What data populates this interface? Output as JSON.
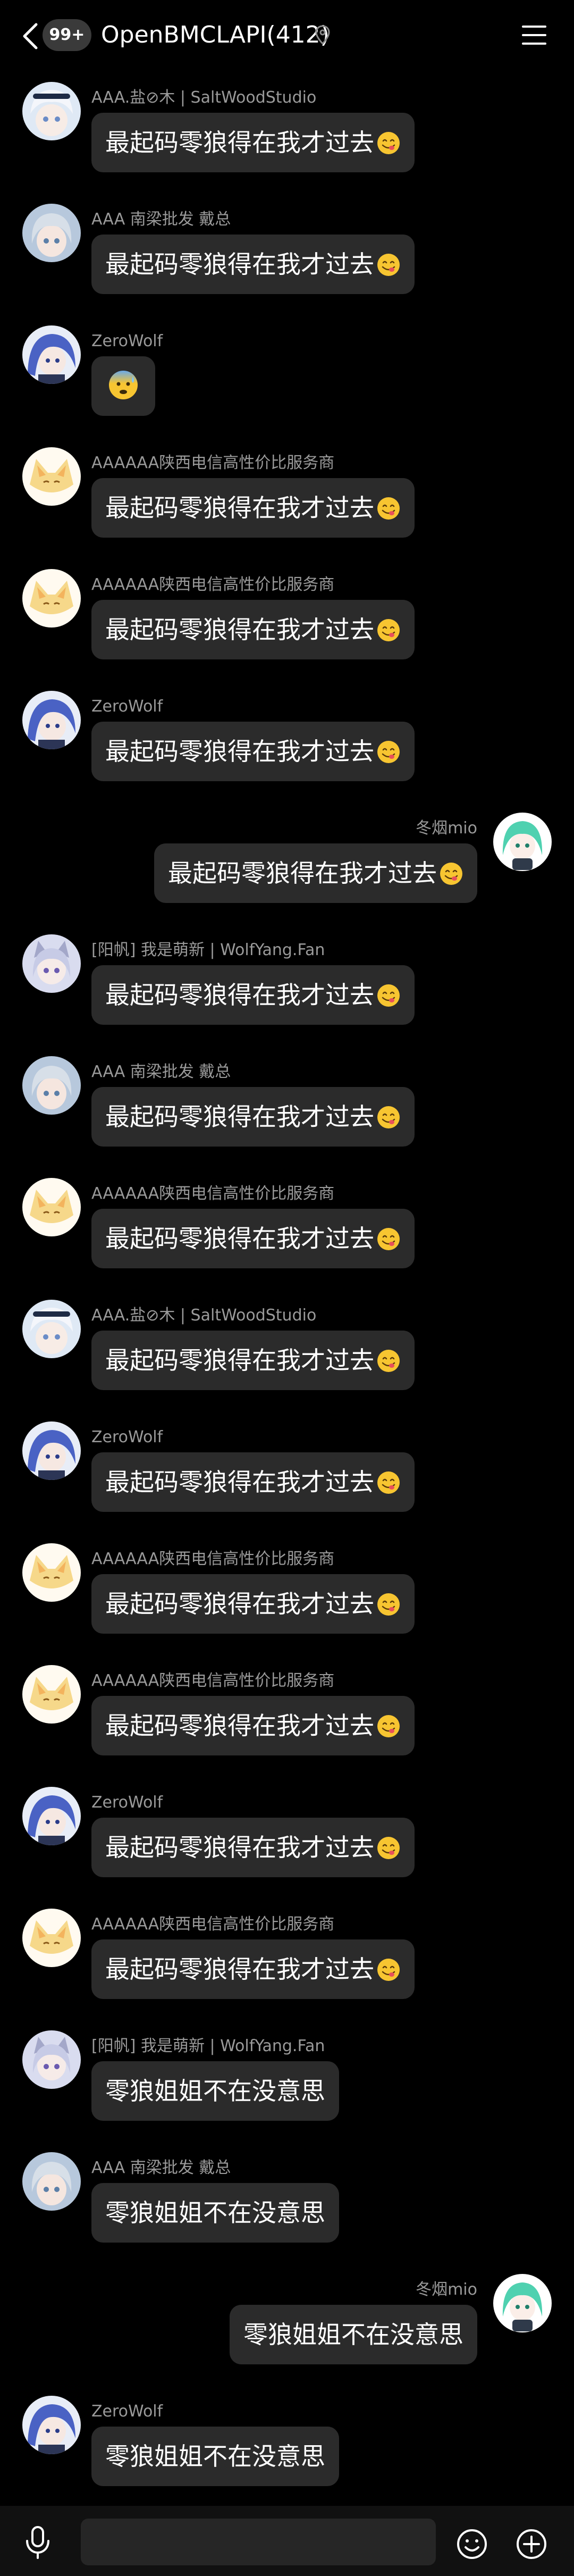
{
  "header": {
    "unread_badge": "99+",
    "title": "OpenBMCLAPI(412)"
  },
  "colors": {
    "background": "#000000",
    "bubble": "#2b2b2b",
    "sender_text": "#9a9a9a",
    "badge": "#3a3a3a"
  },
  "messages": [
    {
      "sender": "AAA.盐⊘木 | SaltWoodStudio",
      "text": "最起码零狼得在我才过去",
      "emoji": "face-savoring-food",
      "side": "left",
      "avatar": "avatar-white-hair"
    },
    {
      "sender": "AAA 南梁批发 戴总",
      "text": "最起码零狼得在我才过去",
      "emoji": "face-savoring-food",
      "side": "left",
      "avatar": "avatar-silver-hair"
    },
    {
      "sender": "ZeroWolf",
      "text": "",
      "emoji": "anxious-face-with-sweat",
      "side": "left",
      "avatar": "avatar-blue-hair"
    },
    {
      "sender": "AAAAAA陕西电信高性价比服务商",
      "text": "最起码零狼得在我才过去",
      "emoji": "face-savoring-food",
      "side": "left",
      "avatar": "avatar-fox"
    },
    {
      "sender": "AAAAAA陕西电信高性价比服务商",
      "text": "最起码零狼得在我才过去",
      "emoji": "face-savoring-food",
      "side": "left",
      "avatar": "avatar-fox"
    },
    {
      "sender": "ZeroWolf",
      "text": "最起码零狼得在我才过去",
      "emoji": "face-savoring-food",
      "side": "left",
      "avatar": "avatar-blue-hair"
    },
    {
      "sender": "冬烟mio",
      "text": "最起码零狼得在我才过去",
      "emoji": "face-savoring-food",
      "side": "right",
      "avatar": "avatar-green-hair"
    },
    {
      "sender": "[阳帆] 我是萌新 | WolfYang.Fan",
      "text": "最起码零狼得在我才过去",
      "emoji": "face-savoring-food",
      "side": "left",
      "avatar": "avatar-wolf-girl"
    },
    {
      "sender": "AAA 南梁批发 戴总",
      "text": "最起码零狼得在我才过去",
      "emoji": "face-savoring-food",
      "side": "left",
      "avatar": "avatar-silver-hair"
    },
    {
      "sender": "AAAAAA陕西电信高性价比服务商",
      "text": "最起码零狼得在我才过去",
      "emoji": "face-savoring-food",
      "side": "left",
      "avatar": "avatar-fox"
    },
    {
      "sender": "AAA.盐⊘木 | SaltWoodStudio",
      "text": "最起码零狼得在我才过去",
      "emoji": "face-savoring-food",
      "side": "left",
      "avatar": "avatar-white-hair"
    },
    {
      "sender": "ZeroWolf",
      "text": "最起码零狼得在我才过去",
      "emoji": "face-savoring-food",
      "side": "left",
      "avatar": "avatar-blue-hair"
    },
    {
      "sender": "AAAAAA陕西电信高性价比服务商",
      "text": "最起码零狼得在我才过去",
      "emoji": "face-savoring-food",
      "side": "left",
      "avatar": "avatar-fox"
    },
    {
      "sender": "AAAAAA陕西电信高性价比服务商",
      "text": "最起码零狼得在我才过去",
      "emoji": "face-savoring-food",
      "side": "left",
      "avatar": "avatar-fox"
    },
    {
      "sender": "ZeroWolf",
      "text": "最起码零狼得在我才过去",
      "emoji": "face-savoring-food",
      "side": "left",
      "avatar": "avatar-blue-hair"
    },
    {
      "sender": "AAAAAA陕西电信高性价比服务商",
      "text": "最起码零狼得在我才过去",
      "emoji": "face-savoring-food",
      "side": "left",
      "avatar": "avatar-fox"
    },
    {
      "sender": "[阳帆] 我是萌新 | WolfYang.Fan",
      "text": "零狼姐姐不在没意思",
      "emoji": "",
      "side": "left",
      "avatar": "avatar-wolf-girl"
    },
    {
      "sender": "AAA 南梁批发 戴总",
      "text": "零狼姐姐不在没意思",
      "emoji": "",
      "side": "left",
      "avatar": "avatar-silver-hair"
    },
    {
      "sender": "冬烟mio",
      "text": "零狼姐姐不在没意思",
      "emoji": "",
      "side": "right",
      "avatar": "avatar-green-hair"
    },
    {
      "sender": "ZeroWolf",
      "text": "零狼姐姐不在没意思",
      "emoji": "",
      "side": "left",
      "avatar": "avatar-blue-hair"
    }
  ],
  "input": {
    "placeholder": "",
    "value": ""
  },
  "icons": {
    "back": "back-chevron-icon",
    "location": "location-pin-icon",
    "menu": "hamburger-menu-icon",
    "voice": "microphone-icon",
    "emoji": "smiley-icon",
    "more": "plus-circle-icon"
  }
}
